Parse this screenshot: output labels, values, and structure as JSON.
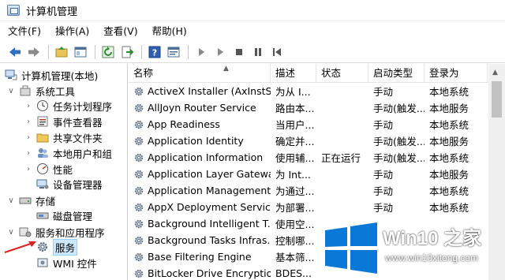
{
  "window": {
    "title": "计算机管理"
  },
  "menu": [
    "文件(F)",
    "操作(A)",
    "查看(V)",
    "帮助(H)"
  ],
  "toolbar": {
    "buttons": [
      "back-icon",
      "forward-icon",
      "up-folder-icon",
      "show-hide-tree-icon",
      "refresh-icon",
      "export-icon",
      "help-icon",
      "properties-icon",
      "play-icon",
      "play-alt-icon",
      "stop-icon",
      "pause-icon",
      "restart-icon"
    ]
  },
  "tree": {
    "items": [
      {
        "label": "计算机管理(本地)",
        "icon": "computer-mgmt-icon",
        "arrow": ""
      },
      {
        "label": "系统工具",
        "icon": "tools-icon",
        "arrow": "∨"
      },
      {
        "label": "任务计划程序",
        "icon": "clock-icon",
        "arrow": "›"
      },
      {
        "label": "事件查看器",
        "icon": "event-viewer-icon",
        "arrow": "›"
      },
      {
        "label": "共享文件夹",
        "icon": "shared-folder-icon",
        "arrow": "›"
      },
      {
        "label": "本地用户和组",
        "icon": "users-icon",
        "arrow": "›"
      },
      {
        "label": "性能",
        "icon": "performance-icon",
        "arrow": "›"
      },
      {
        "label": "设备管理器",
        "icon": "device-manager-icon",
        "arrow": ""
      },
      {
        "label": "存储",
        "icon": "storage-icon",
        "arrow": "∨"
      },
      {
        "label": "磁盘管理",
        "icon": "disk-icon",
        "arrow": ""
      },
      {
        "label": "服务和应用程序",
        "icon": "services-apps-icon",
        "arrow": "∨"
      },
      {
        "label": "服务",
        "icon": "services-gear-icon",
        "arrow": ""
      },
      {
        "label": "WMI 控件",
        "icon": "wmi-icon",
        "arrow": ""
      }
    ]
  },
  "list": {
    "columns": [
      "名称",
      "描述",
      "状态",
      "启动类型",
      "登录为"
    ],
    "rows": [
      [
        "ActiveX Installer (AxInstSV)",
        "为从 I...",
        "",
        "手动",
        "本地系统"
      ],
      [
        "AllJoyn Router Service",
        "路由本...",
        "",
        "手动(触发...",
        "本地服务"
      ],
      [
        "App Readiness",
        "当用户...",
        "",
        "手动",
        "本地系统"
      ],
      [
        "Application Identity",
        "确定并...",
        "",
        "手动(触发...",
        "本地服务"
      ],
      [
        "Application Information",
        "使用辅...",
        "正在运行",
        "手动(触发...",
        "本地系统"
      ],
      [
        "Application Layer Gatewa...",
        "为 Int...",
        "",
        "手动",
        "本地服务"
      ],
      [
        "Application Management",
        "为通过...",
        "",
        "手动",
        "本地系统"
      ],
      [
        "AppX Deployment Servic...",
        "为部署...",
        "",
        "手动",
        "本地系统"
      ],
      [
        "Background Intelligent T...",
        "使用空...",
        "",
        "",
        ""
      ],
      [
        "Background Tasks Infras...",
        "控制哪...",
        "",
        "",
        ""
      ],
      [
        "Base Filtering Engine",
        "基本筛...",
        "",
        "",
        ""
      ],
      [
        "BitLocker Drive Encryptio...",
        "BDES...",
        "",
        "",
        ""
      ]
    ]
  },
  "watermark": {
    "text1": "Win10 之家",
    "text2": "www.win10xitong.com"
  },
  "colors": {
    "selection": "#cce8ff",
    "accent": "#2e6fc3",
    "logo_blue": "#0a78d7"
  }
}
